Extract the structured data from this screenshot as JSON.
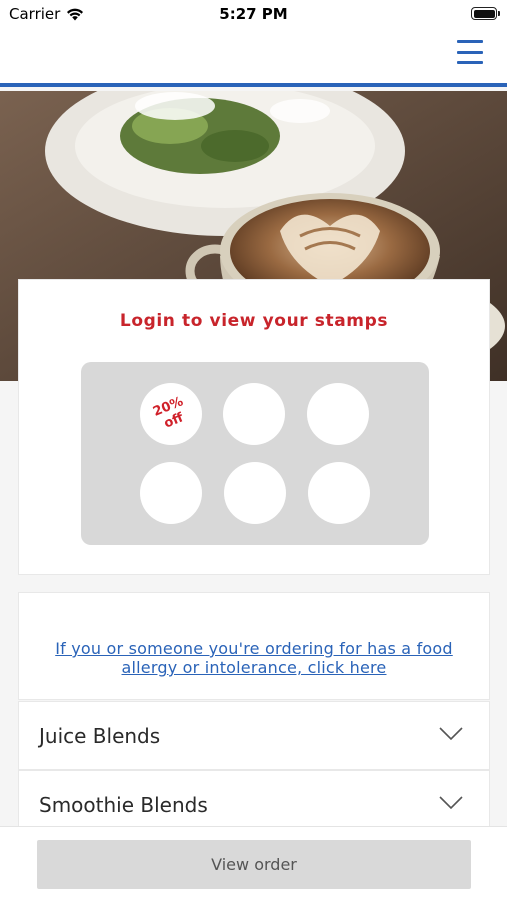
{
  "status_bar": {
    "carrier": "Carrier",
    "time": "5:27 PM"
  },
  "header": {
    "menu_icon": "hamburger-menu-icon"
  },
  "hero": {
    "image": "latte-art-coffee-and-salad-photo"
  },
  "stamps": {
    "title": "Login to view your stamps",
    "reward_label": "20%\noff",
    "total": 6,
    "collected": 0
  },
  "allergy": {
    "link_text": "If you or someone you're ordering for has a food allergy or intolerance, click here"
  },
  "menu_categories": [
    {
      "label": "Juice Blends",
      "icon": "chevron-down-icon"
    },
    {
      "label": "Smoothie Blends",
      "icon": "chevron-down-icon"
    }
  ],
  "footer": {
    "view_order_label": "View order"
  },
  "colors": {
    "accent_blue": "#2a63b8",
    "stamp_red": "#c8242b",
    "board_gray": "#d8d8d8"
  }
}
